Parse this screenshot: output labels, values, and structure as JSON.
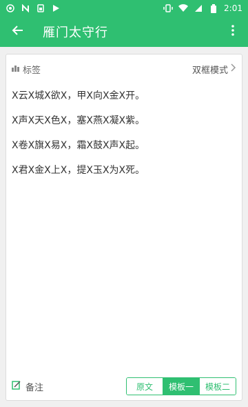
{
  "status_bar": {
    "time": "2:01",
    "icons": [
      "notification-icon",
      "n-icon",
      "sim-icon",
      "play-store-icon",
      "vibrate-icon",
      "wifi-icon",
      "signal-icon",
      "battery-icon"
    ]
  },
  "app_bar": {
    "title": "雁门太守行",
    "back_icon": "arrow-left-icon",
    "more_icon": "more-vert-icon"
  },
  "card": {
    "tag_label": "标签",
    "mode_label": "双框模式",
    "lines": [
      "X云X城X欲X，甲X向X金X开。",
      "X声X天X色X，塞X燕X凝X紫。",
      "X卷X旗X易X，霜X鼓X声X起。",
      "X君X金X上X，提X玉X为X死。"
    ],
    "note_label": "备注",
    "segments": [
      "原文",
      "模板一",
      "模板二"
    ],
    "active_segment": 1
  },
  "colors": {
    "primary": "#2fbf71"
  }
}
